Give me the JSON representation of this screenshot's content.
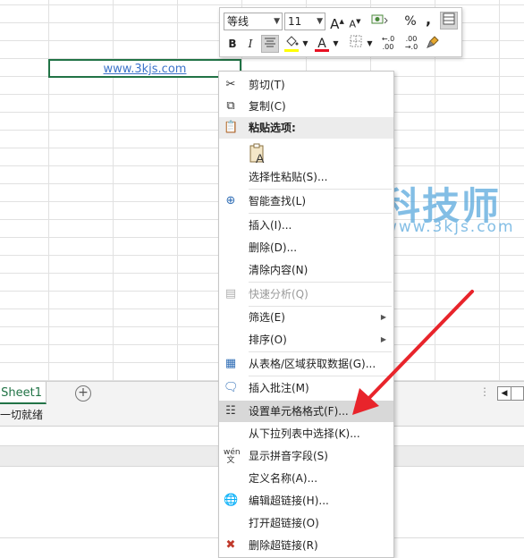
{
  "cell": {
    "value": "www.3kjs.com"
  },
  "sheet_tabs": {
    "active": "Sheet1",
    "add": "+"
  },
  "status": {
    "text": "一切就绪"
  },
  "mini_toolbar": {
    "font_name": "等线",
    "font_size": "11",
    "grow_font": "A",
    "shrink_font": "A",
    "percent": "%",
    "comma": ",",
    "bold": "B",
    "italic": "I",
    "font_color_letter": "A",
    "increase_decimal": "←.0 .00",
    "decrease_decimal": ".00 →.0"
  },
  "menu": {
    "cut": "剪切(T)",
    "copy": "复制(C)",
    "paste_options": "粘贴选项:",
    "paste_special": "选择性粘贴(S)...",
    "smart_lookup": "智能查找(L)",
    "insert": "插入(I)...",
    "delete": "删除(D)...",
    "clear_contents": "清除内容(N)",
    "quick_analysis": "快速分析(Q)",
    "filter": "筛选(E)",
    "sort": "排序(O)",
    "get_data": "从表格/区域获取数据(G)...",
    "insert_comment": "插入批注(M)",
    "format_cells": "设置单元格格式(F)...",
    "pick_from_list": "从下拉列表中选择(K)...",
    "phonetic": "显示拼音字段(S)",
    "define_name": "定义名称(A)...",
    "edit_hyperlink": "编辑超链接(H)...",
    "open_hyperlink": "打开超链接(O)",
    "remove_hyperlink": "删除超链接(R)"
  },
  "watermark": {
    "title": "科技师",
    "subtitle": "www.3kjs.com"
  },
  "colors": {
    "accent": "#217346",
    "arrow": "#e8242b",
    "font_red": "#e81123",
    "highlight": "#ffff00"
  }
}
